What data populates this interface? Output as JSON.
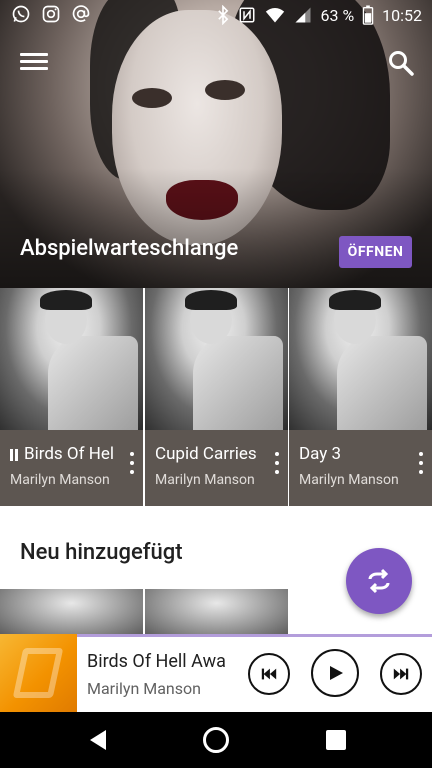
{
  "status_bar": {
    "battery": "63 %",
    "time": "10:52",
    "left_icons": [
      "whatsapp-icon",
      "instagram-icon",
      "at-icon"
    ],
    "right_icons": [
      "bluetooth-icon",
      "nfc-icon",
      "wifi-icon",
      "signal-icon",
      "battery-icon"
    ]
  },
  "header": {
    "menu_icon": "menu-icon",
    "search_icon": "search-icon"
  },
  "queue": {
    "title": "Abspielwarteschlange",
    "open_label": "ÖFFNEN",
    "items": [
      {
        "title": "Birds Of Hel",
        "artist": "Marilyn Manson",
        "playing": true
      },
      {
        "title": "Cupid Carries",
        "artist": "Marilyn Manson",
        "playing": false
      },
      {
        "title": "Day 3",
        "artist": "Marilyn Manson",
        "playing": false
      }
    ]
  },
  "recent": {
    "title": "Neu hinzugefügt"
  },
  "fab": {
    "icon": "shuffle-icon"
  },
  "now_playing": {
    "title": "Birds Of Hell Awa",
    "artist": "Marilyn Manson"
  },
  "colors": {
    "accent": "#7e57c2",
    "card_bg": "#5d5651",
    "now_playing_art": "#f39200"
  }
}
